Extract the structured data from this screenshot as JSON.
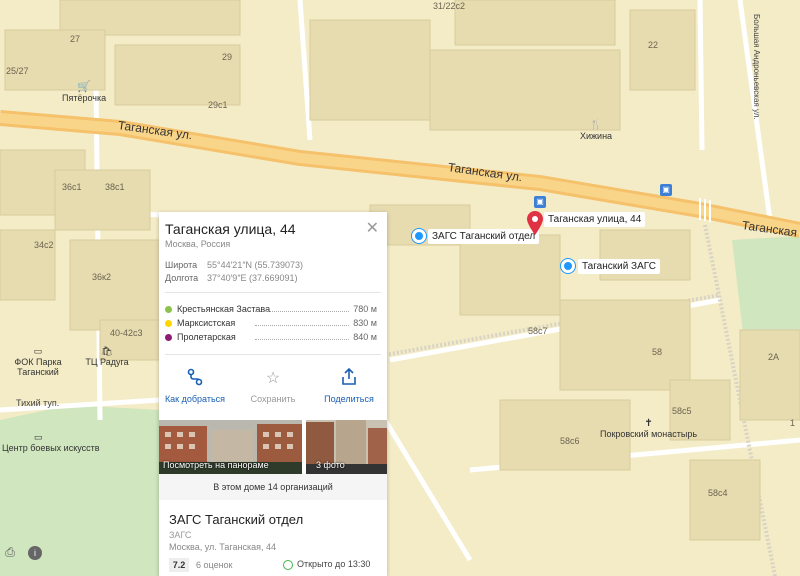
{
  "map": {
    "streets": {
      "taganskaya_1": "Таганская ул.",
      "taganskaya_2": "Таганская ул.",
      "taganskaya_3": "Таганская",
      "tikhiy": "Тихий туп.",
      "andronyevskaya": "Большая Андроньевская ул."
    },
    "buildings": {
      "b27": "27",
      "b25_27": "25/27",
      "b29": "29",
      "b29c1": "29с1",
      "b31_22c2": "31/22с2",
      "b22": "22",
      "b36c1": "36с1",
      "b38c1": "38с1",
      "b34c2": "34с2",
      "b36k2": "36к2",
      "b40_42c3": "40-42с3",
      "b58c7": "58с7",
      "b58": "58",
      "b58c5": "58с5",
      "b58c6": "58с6",
      "b58c4": "58с4",
      "b2a": "2А",
      "b1": "1"
    },
    "pois": {
      "pyaterochka": "Пятёрочка",
      "khizhina": "Хижина",
      "fok": "ФОК Парка Таганский",
      "tc_raduga": "ТЦ Радуга",
      "boevykh": "Центр боевых искусств",
      "pokrovsky": "Покровский монастырь"
    },
    "markers": {
      "zags_otdel": "ЗАГС Таганский отдел",
      "taganskaya_44": "Таганская улица, 44",
      "taganskiy_zags": "Таганский ЗАГС"
    }
  },
  "panel": {
    "title": "Таганская улица, 44",
    "subtitle": "Москва, Россия",
    "latitude_label": "Широта",
    "latitude_value": "55°44′21″N (55.739073)",
    "longitude_label": "Долгота",
    "longitude_value": "37°40′9″E (37.669091)",
    "metro": [
      {
        "name": "Крестьянская Застава",
        "distance": "780 м",
        "color": "#8bc34a"
      },
      {
        "name": "Марксистская",
        "distance": "830 м",
        "color": "#ffd600"
      },
      {
        "name": "Пролетарская",
        "distance": "840 м",
        "color": "#8e1a76"
      }
    ],
    "actions": {
      "route": "Как добраться",
      "save": "Сохранить",
      "share": "Поделиться"
    },
    "photos": {
      "panorama": "Посмотреть на панораме",
      "count": "3 фото"
    },
    "orgs_in_building": "В этом доме 14 организаций",
    "org": {
      "name": "ЗАГС Таганский отдел",
      "category": "ЗАГС",
      "address": "Москва, ул. Таганская, 44",
      "rating": "7.2",
      "reviews": "6 оценок",
      "hours": "Открыто до 13:30"
    }
  },
  "colors": {
    "road_major": "#f5c16b",
    "map_bg": "#f4ecc7",
    "building": "#e7dbb0",
    "park": "#cfe6bf",
    "accent": "#1e98ff",
    "link": "#1a5fb4",
    "red_pin": "#e03244"
  }
}
